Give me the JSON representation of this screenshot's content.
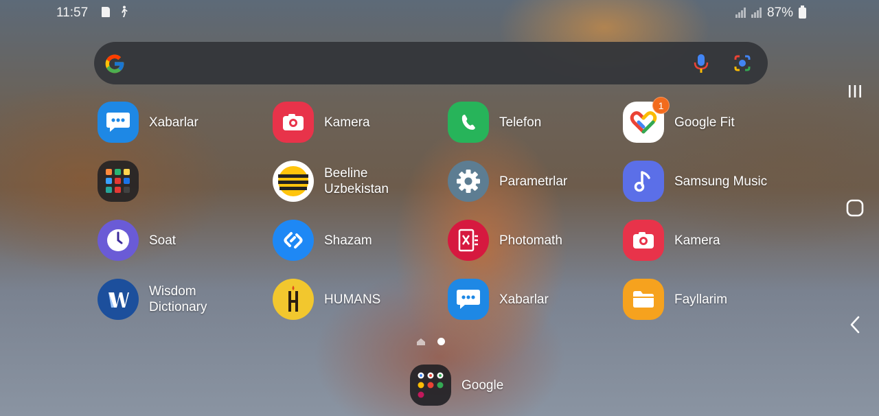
{
  "status_bar": {
    "time": "11:57",
    "battery_percent": "87%",
    "icons": [
      "sd-card-icon",
      "walking-icon",
      "signal-icon",
      "signal-icon",
      "battery-icon"
    ]
  },
  "search_bar": {
    "icons": [
      "google-logo-icon",
      "microphone-icon",
      "google-lens-icon"
    ]
  },
  "apps": [
    {
      "label": "Xabarlar",
      "icon": "messages-icon"
    },
    {
      "label": "Kamera",
      "icon": "camera-icon"
    },
    {
      "label": "Telefon",
      "icon": "phone-icon"
    },
    {
      "label": "Google Fit",
      "icon": "google-fit-icon",
      "badge": "1"
    },
    {
      "label": "",
      "icon": "folder-icon"
    },
    {
      "label_line1": "Beeline",
      "label_line2": "Uzbekistan",
      "icon": "beeline-icon"
    },
    {
      "label": "Parametrlar",
      "icon": "settings-icon"
    },
    {
      "label": "Samsung Music",
      "icon": "music-icon"
    },
    {
      "label": "Soat",
      "icon": "clock-icon"
    },
    {
      "label": "Shazam",
      "icon": "shazam-icon"
    },
    {
      "label": "Photomath",
      "icon": "photomath-icon"
    },
    {
      "label": "Kamera",
      "icon": "camera-icon"
    },
    {
      "label_line1": "Wisdom",
      "label_line2": "Dictionary",
      "icon": "wisdom-dictionary-icon"
    },
    {
      "label": "HUMANS",
      "icon": "humans-icon"
    },
    {
      "label": "Xabarlar",
      "icon": "messages-icon"
    },
    {
      "label": "Fayllarim",
      "icon": "files-icon"
    }
  ],
  "pager": {
    "pages": 2,
    "current": 2
  },
  "dock": {
    "label": "Google",
    "icon": "google-folder-icon"
  },
  "nav_bar": {
    "icons": [
      "recents-icon",
      "home-icon",
      "back-icon"
    ]
  }
}
